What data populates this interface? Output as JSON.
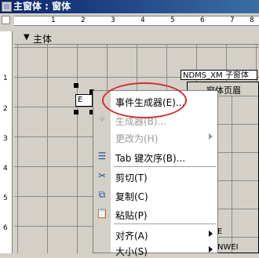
{
  "window": {
    "title": "主窗体 : 窗体"
  },
  "ruler": {
    "h_ticks": [
      "1",
      "2",
      "3",
      "4",
      "5",
      "6",
      "7",
      "8",
      "9"
    ],
    "v_ticks": [
      "1",
      "2",
      "3",
      "4",
      "5",
      "6"
    ]
  },
  "section": {
    "main_label": "主体"
  },
  "controls": {
    "text_box_glyph": "E"
  },
  "subform": {
    "label": "NDMS_XM 子窗体",
    "header_label": "窗体页眉",
    "text_1": "E",
    "text_2": "NWEI"
  },
  "context_menu": {
    "items": [
      {
        "label": "事件生成器(E)...",
        "enabled": true,
        "submenu": false,
        "icon": ""
      },
      {
        "label": "生成器(B)...",
        "enabled": false,
        "submenu": false,
        "icon": "builder-icon"
      },
      {
        "label": "更改为(H)",
        "enabled": false,
        "submenu": true,
        "icon": ""
      },
      {
        "label": "Tab 键次序(B)...",
        "enabled": true,
        "submenu": false,
        "icon": "tab-order-icon"
      },
      {
        "label": "剪切(T)",
        "enabled": true,
        "submenu": false,
        "icon": "cut-icon"
      },
      {
        "label": "复制(C)",
        "enabled": true,
        "submenu": false,
        "icon": "copy-icon"
      },
      {
        "label": "粘贴(P)",
        "enabled": true,
        "submenu": false,
        "icon": "paste-icon"
      },
      {
        "label": "对齐(A)",
        "enabled": true,
        "submenu": true,
        "icon": ""
      },
      {
        "label": "大小(S)",
        "enabled": true,
        "submenu": true,
        "icon": ""
      }
    ]
  },
  "colors": {
    "title_bar": "#0a246a",
    "highlight_oval": "#d03030",
    "menu_bg": "#ffffff",
    "form_bg": "#d4d0c8"
  }
}
